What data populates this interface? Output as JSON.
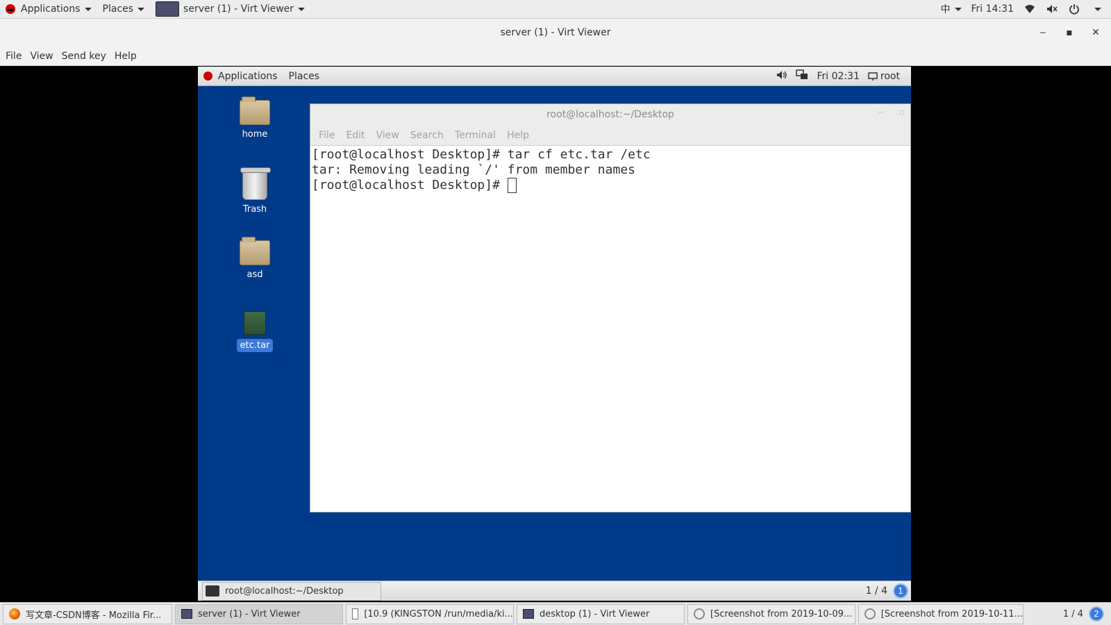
{
  "host_top": {
    "applications": "Applications",
    "places": "Places",
    "window_title": "server (1) - Virt Viewer",
    "input_method": "中",
    "clock": "Fri 14:31"
  },
  "virt_viewer": {
    "title": "server (1) - Virt Viewer",
    "menus": [
      "File",
      "View",
      "Send key",
      "Help"
    ]
  },
  "guest_panel": {
    "applications": "Applications",
    "places": "Places",
    "clock": "Fri 02:31",
    "user": "root"
  },
  "desktop_icons": [
    "home",
    "Trash",
    "asd",
    "etc.tar"
  ],
  "terminal": {
    "title": "root@localhost:~/Desktop",
    "menus": [
      "File",
      "Edit",
      "View",
      "Search",
      "Terminal",
      "Help"
    ],
    "lines": [
      "[root@localhost Desktop]# tar cf etc.tar /etc",
      "tar: Removing leading `/' from member names",
      "[root@localhost Desktop]# "
    ]
  },
  "guest_bottom": {
    "task": "root@localhost:~/Desktop",
    "workspace": "1 / 4",
    "badge": "1"
  },
  "host_bottom": {
    "tasks": [
      "写文章-CSDN博客 - Mozilla Fir...",
      "server (1) - Virt Viewer",
      "[10.9 (KINGSTON /run/media/ki...",
      "desktop (1) - Virt Viewer",
      "[Screenshot from 2019-10-09...",
      "[Screenshot from 2019-10-11..."
    ],
    "workspace": "1 / 4",
    "badge": "2"
  }
}
